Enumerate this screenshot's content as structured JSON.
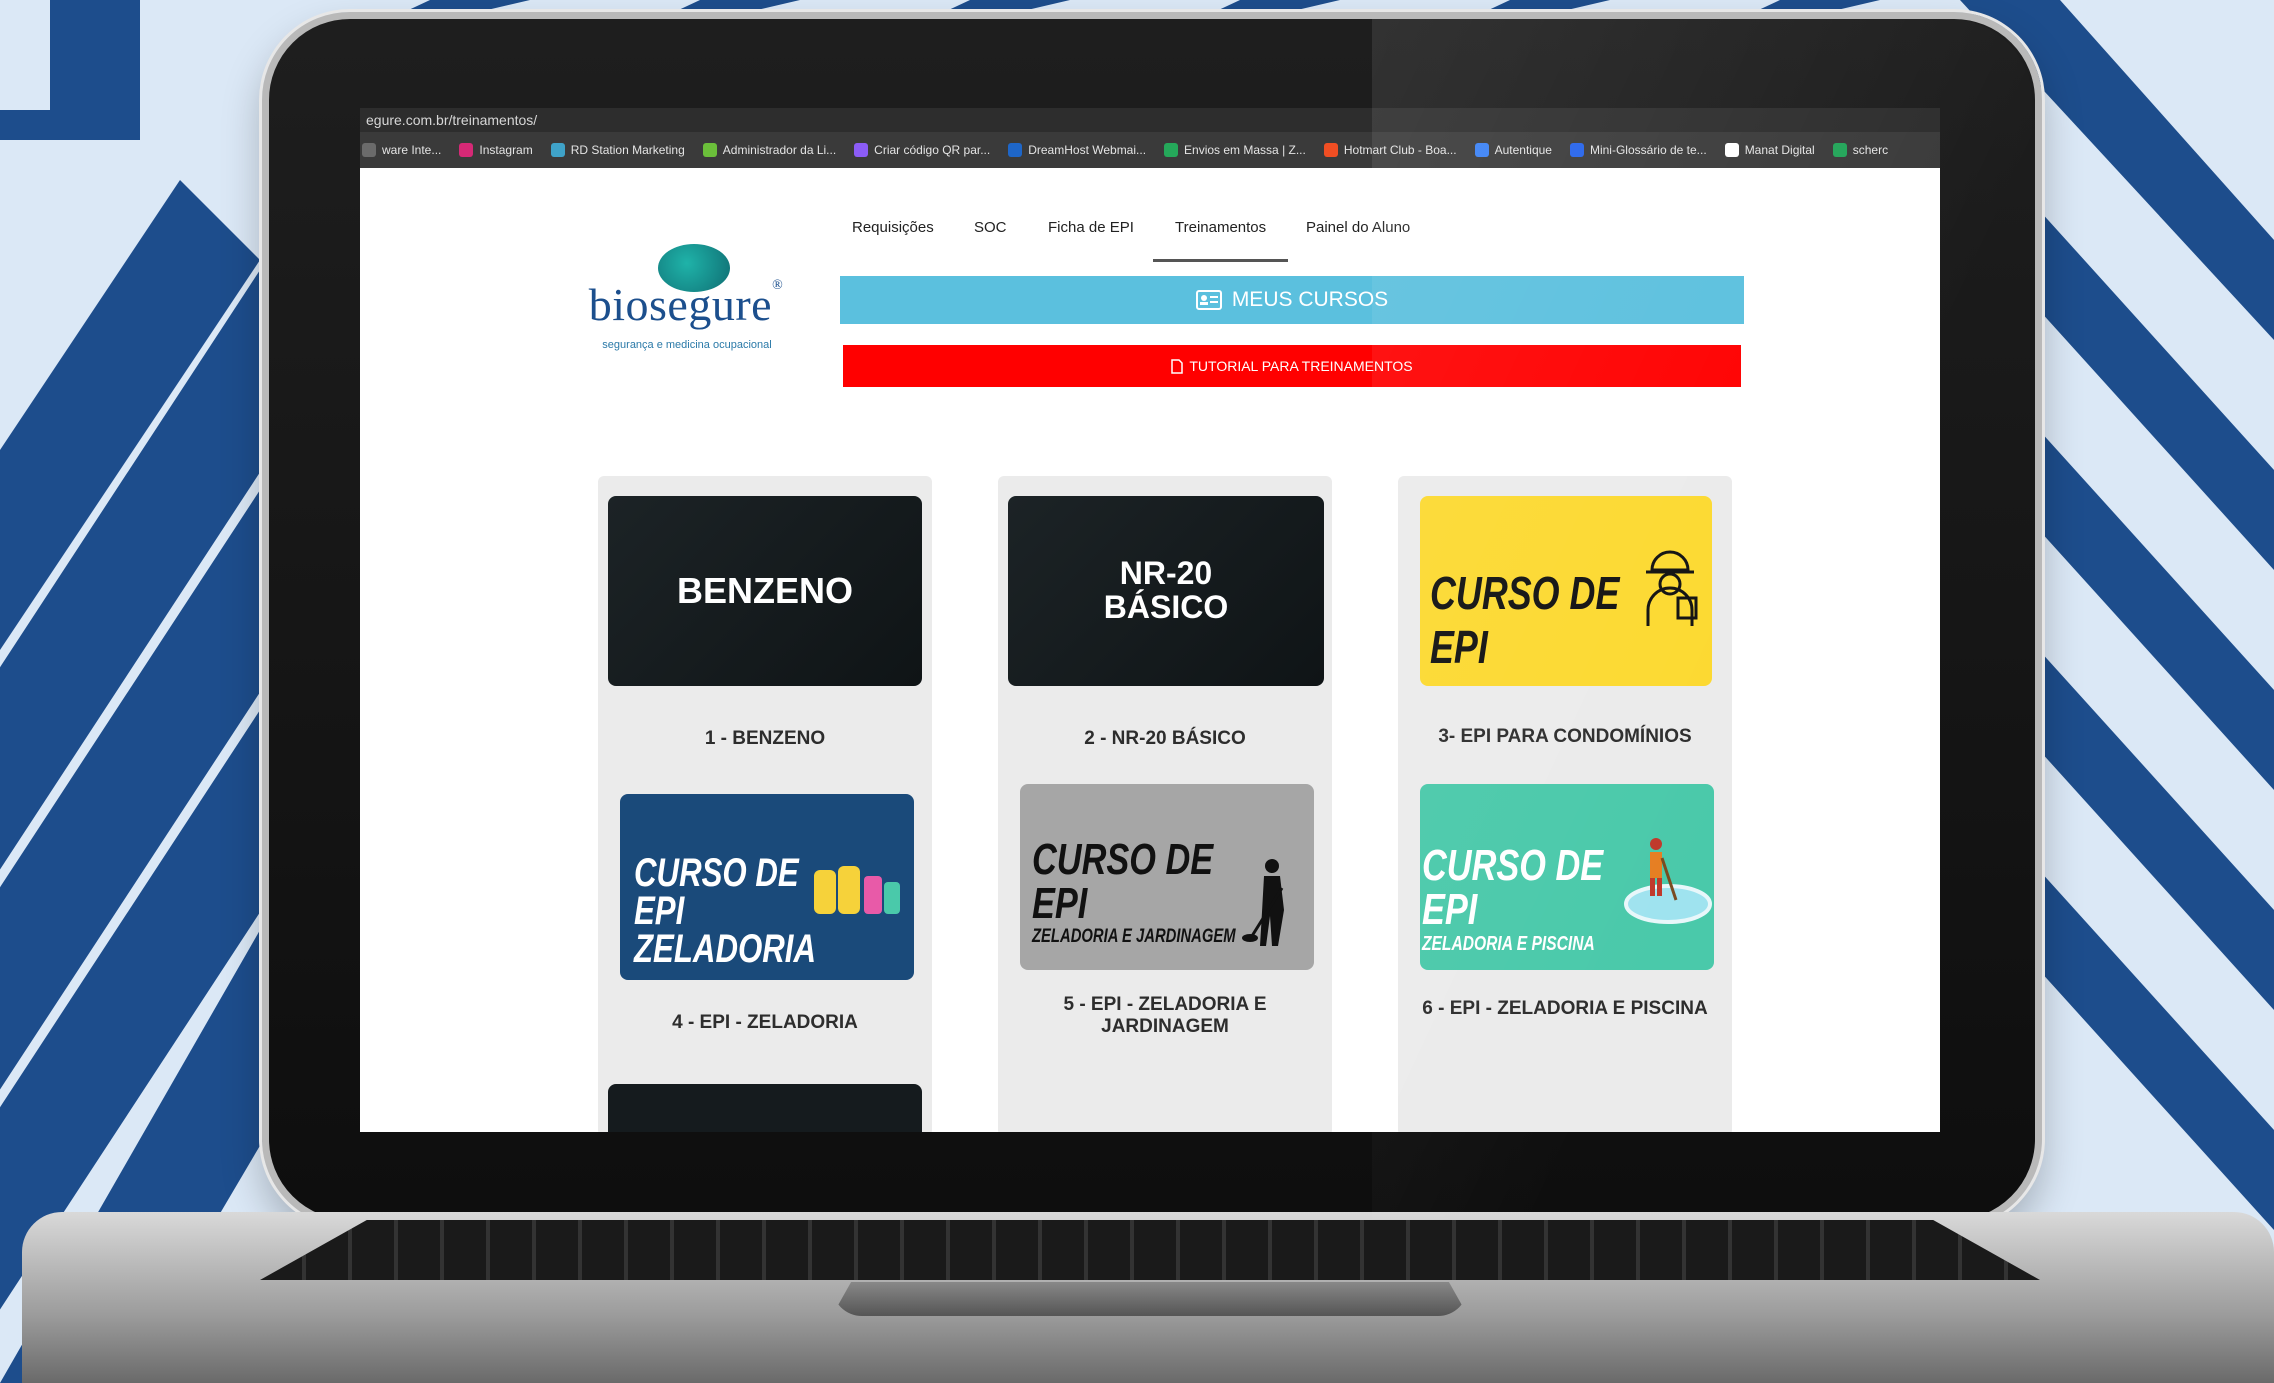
{
  "browser": {
    "url": "egure.com.br/treinamentos/",
    "bookmarks": [
      {
        "label": "ware Inte...",
        "color": "#6b6b6b"
      },
      {
        "label": "Instagram",
        "color": "#d62976"
      },
      {
        "label": "RD Station Marketing",
        "color": "#3fa3c9"
      },
      {
        "label": "Administrador da Li...",
        "color": "#6bbf3a"
      },
      {
        "label": "Criar código QR par...",
        "color": "#8b5cf6"
      },
      {
        "label": "DreamHost Webmai...",
        "color": "#1e66c8"
      },
      {
        "label": "Envios em Massa | Z...",
        "color": "#25a85a"
      },
      {
        "label": "Hotmart Club - Boa...",
        "color": "#f04e23"
      },
      {
        "label": "Autentique",
        "color": "#3b82f6"
      },
      {
        "label": "Mini-Glossário de te...",
        "color": "#2563eb"
      },
      {
        "label": "Manat Digital",
        "color": "#ffffff"
      },
      {
        "label": "scherc",
        "color": "#22a559"
      }
    ]
  },
  "nav": {
    "tabs": [
      "Requisições",
      "SOC",
      "Ficha de EPI",
      "Treinamentos",
      "Painel do Aluno"
    ],
    "active": "Treinamentos"
  },
  "logo": {
    "name": "biosegure",
    "registered": "®",
    "tagline": "segurança e medicina ocupacional"
  },
  "buttons": {
    "courses": "MEUS CURSOS",
    "tutorial": "TUTORIAL PARA TREINAMENTOS"
  },
  "courses": [
    {
      "image_text": "BENZENO",
      "title": "1 - BENZENO"
    },
    {
      "image_text": "NR-20\nBÁSICO",
      "title": "2 - NR-20 BÁSICO"
    },
    {
      "image_text": "CURSO DE EPI",
      "title": "3- EPI PARA CONDOMÍNIOS"
    },
    {
      "image_text": "CURSO DE EPI",
      "image_subtext": "ZELADORIA",
      "title": "4 - EPI - ZELADORIA"
    },
    {
      "image_text": "CURSO DE EPI",
      "image_subtext": "ZELADORIA E JARDINAGEM",
      "title": "5 - EPI - ZELADORIA E JARDINAGEM"
    },
    {
      "image_text": "CURSO DE EPI",
      "image_subtext": "ZELADORIA E PISCINA",
      "title": "6 - EPI - ZELADORIA E PISCINA"
    }
  ],
  "colors": {
    "courses_button": "#5bc0de",
    "tutorial_button": "#ff0000",
    "tile_yellow": "#fcd930",
    "tile_blue": "#1a4a7a",
    "tile_grey": "#a6a6a6",
    "tile_green": "#4ac9aa"
  }
}
